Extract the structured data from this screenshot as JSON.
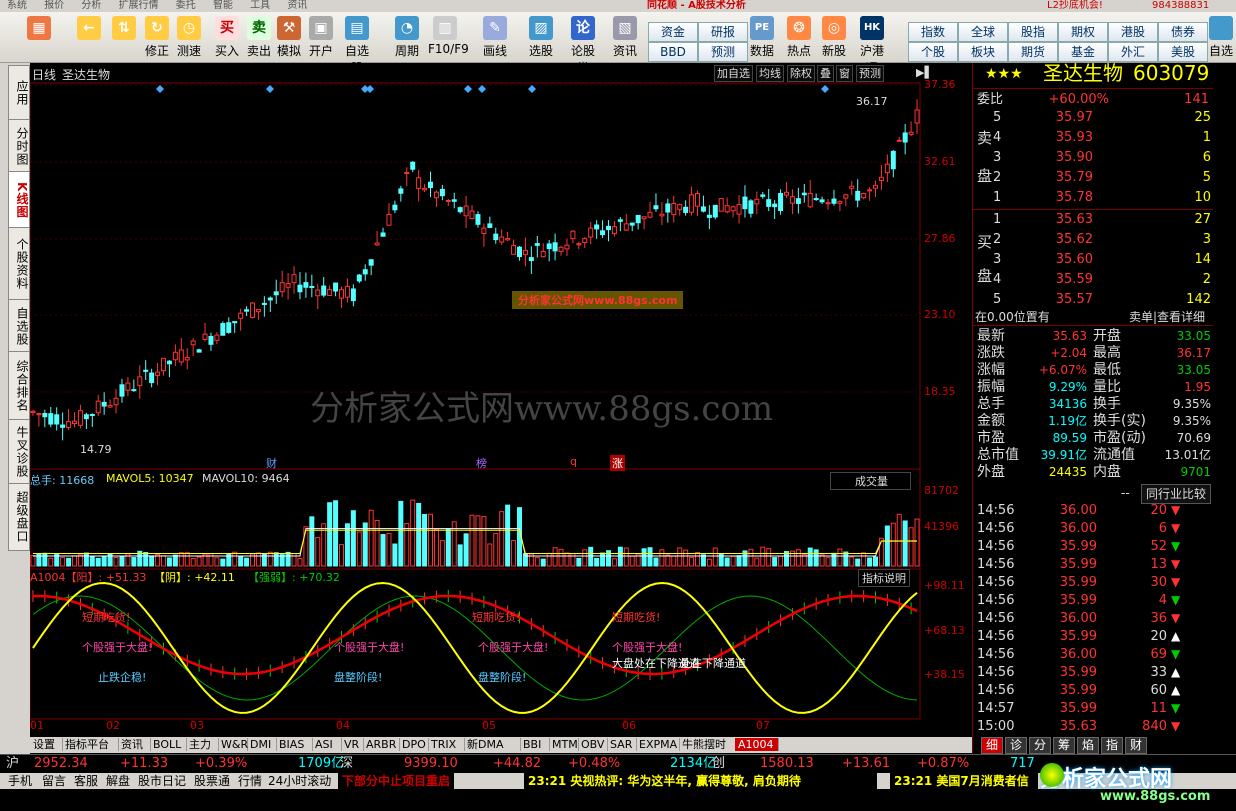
{
  "app": {
    "title": "同花顺 - A股技术分析",
    "promo": "L2抄底机会!",
    "account": "984388831"
  },
  "menu": [
    "系统",
    "报价",
    "分析",
    "扩展行情",
    "委托",
    "智能",
    "工具",
    "资讯"
  ],
  "toolbar": [
    {
      "name": "layout",
      "label": "",
      "icon": "▦"
    },
    {
      "name": "back",
      "label": "",
      "icon": "←"
    },
    {
      "name": "up-down",
      "label": "",
      "icon": "⇅"
    },
    {
      "name": "modify",
      "label": "修正",
      "icon": "↻"
    },
    {
      "name": "test",
      "label": "测速",
      "icon": "◷"
    },
    {
      "name": "buy",
      "label": "买入",
      "icon": "买"
    },
    {
      "name": "sell",
      "label": "卖出",
      "icon": "卖"
    },
    {
      "name": "simulate",
      "label": "模拟",
      "icon": "⚒"
    },
    {
      "name": "open",
      "label": "开户",
      "icon": "▣"
    },
    {
      "name": "watchlist",
      "label": "自选股",
      "icon": "▤"
    },
    {
      "name": "period",
      "label": "周期",
      "icon": "◔"
    },
    {
      "name": "f10",
      "label": "F10/F9",
      "icon": "▥"
    },
    {
      "name": "draw",
      "label": "画线",
      "icon": "✎"
    },
    {
      "name": "stockpick",
      "label": "选股",
      "icon": "▨"
    },
    {
      "name": "forum",
      "label": "论股堂",
      "icon": "论"
    },
    {
      "name": "news",
      "label": "资讯",
      "icon": "▧"
    },
    {
      "name": "data",
      "label": "数据",
      "icon": "PE"
    },
    {
      "name": "hot",
      "label": "热点",
      "icon": "❂"
    },
    {
      "name": "newstock",
      "label": "新股",
      "icon": "◎"
    },
    {
      "name": "hkconnect",
      "label": "沪港通",
      "icon": "HK"
    }
  ],
  "quick_buttons": [
    "资金",
    "研报",
    "BBD",
    "预测",
    "指数",
    "全球",
    "股指",
    "期权",
    "港股",
    "债券",
    "个股",
    "板块",
    "期货",
    "基金",
    "外汇",
    "美股"
  ],
  "toolbar_right": "自选",
  "left_tabs": [
    "应用",
    "分时图",
    "K线图",
    "个股资料",
    "自选股",
    "综合排名",
    "牛叉诊股",
    "超级盘口"
  ],
  "chart": {
    "period": "日线",
    "name": "圣达生物",
    "buttons": [
      "加自选",
      "均线",
      "除权",
      "叠",
      "窗",
      "预测"
    ],
    "price_axis": [
      "37.36",
      "32.61",
      "27.86",
      "23.10",
      "18.35"
    ],
    "high_label": "36.17",
    "low_label": "14.79",
    "watermark1": "分析家公式网www.88gs.com",
    "watermark2": "分析家公式网www.88gs.com",
    "events": [
      "财",
      "榜",
      "q",
      "涨"
    ],
    "vol_header": {
      "a": "总手: 11668",
      "b": "MAVOL5: 10347",
      "c": "MAVOL10: 9464"
    },
    "vol_select": "成交量",
    "vol_axis": [
      "81702",
      "41396"
    ],
    "ind_header": {
      "a": "A1004【阳】: +51.33",
      "b": "【阴】: +42.11",
      "c": "【强弱】: +70.32"
    },
    "ind_button": "指标说明",
    "ind_axis": [
      "+98.11",
      "+68.13",
      "+38.15"
    ],
    "ind_notes": [
      "短期吃货!",
      "个股强于大盘!",
      "大盘处在下降通道",
      "处在下降通道",
      "盘整阶段!",
      "止跌企稳!"
    ],
    "months": [
      "01",
      "02",
      "03",
      "04",
      "05",
      "06",
      "07"
    ]
  },
  "quote": {
    "stars": "★★★",
    "name": "圣达生物",
    "code": "603079",
    "weibi_label": "委比",
    "weibi": "+60.00%",
    "weicha": "141",
    "sell_label": [
      "卖",
      "盘"
    ],
    "buy_label": [
      "买",
      "盘"
    ],
    "sell": [
      [
        "5",
        "35.97",
        "25"
      ],
      [
        "4",
        "35.93",
        "1"
      ],
      [
        "3",
        "35.90",
        "6"
      ],
      [
        "2",
        "35.79",
        "5"
      ],
      [
        "1",
        "35.78",
        "10"
      ]
    ],
    "buy": [
      [
        "1",
        "35.63",
        "27"
      ],
      [
        "2",
        "35.62",
        "3"
      ],
      [
        "3",
        "35.60",
        "14"
      ],
      [
        "4",
        "35.59",
        "2"
      ],
      [
        "5",
        "35.57",
        "142"
      ]
    ],
    "pos_text": "在0.00位置有",
    "pos_right": "卖单|查看详细",
    "stats": [
      [
        "最新",
        "35.63",
        "开盘",
        "33.05"
      ],
      [
        "涨跌",
        "+2.04",
        "最高",
        "36.17"
      ],
      [
        "涨幅",
        "+6.07%",
        "最低",
        "33.05"
      ],
      [
        "振幅",
        "9.29%",
        "量比",
        "1.95"
      ],
      [
        "总手",
        "34136",
        "换手",
        "9.35%"
      ],
      [
        "金额",
        "1.19亿",
        "换手(实)",
        "9.35%"
      ],
      [
        "市盈",
        "89.59",
        "市盈(动)",
        "70.69"
      ],
      [
        "总市值",
        "39.91亿",
        "流通值",
        "13.01亿"
      ],
      [
        "外盘",
        "24435",
        "内盘",
        "9701"
      ]
    ],
    "compare": "同行业比较",
    "ticks": [
      [
        "14:56",
        "36.00",
        "20",
        "dn"
      ],
      [
        "14:56",
        "36.00",
        "6",
        "dn"
      ],
      [
        "14:56",
        "35.99",
        "52",
        "dn"
      ],
      [
        "14:56",
        "35.99",
        "13",
        "dn"
      ],
      [
        "14:56",
        "35.99",
        "30",
        "dn"
      ],
      [
        "14:56",
        "35.99",
        "4",
        "dn"
      ],
      [
        "14:56",
        "36.00",
        "36",
        "dn"
      ],
      [
        "14:56",
        "35.99",
        "20",
        "up"
      ],
      [
        "14:56",
        "36.00",
        "69",
        "dn"
      ],
      [
        "14:56",
        "35.99",
        "33",
        "up"
      ],
      [
        "14:56",
        "35.99",
        "60",
        "up"
      ],
      [
        "14:57",
        "35.99",
        "11",
        "dn"
      ],
      [
        "15:00",
        "35.63",
        "840",
        "dn"
      ]
    ],
    "right_tabs": [
      "细",
      "诊",
      "分",
      "筹",
      "焰",
      "指",
      "财"
    ]
  },
  "bottom_tabs": [
    "设置",
    "指标平台",
    "资讯",
    "BOLL",
    "主力",
    "W&R",
    "DMI",
    "BIAS",
    "ASI",
    "VR",
    "ARBR",
    "DPO",
    "TRIX",
    "新DMA",
    "BBI",
    "MTM",
    "OBV",
    "SAR",
    "EXPMA",
    "牛熊摆时",
    "A1004"
  ],
  "index_bar": {
    "sh": "沪",
    "sh_val": "2952.34",
    "sh_chg": "+11.33",
    "sh_pct": "+0.39%",
    "sh_amt": "1709亿",
    "sz": "深",
    "sz_val": "9399.10",
    "sz_chg": "+44.82",
    "sz_pct": "+0.48%",
    "sz_amt": "2134亿",
    "cy": "创",
    "cy_val": "1580.13",
    "cy_chg": "+13.61",
    "cy_pct": "+0.87%",
    "cy_amt": "717"
  },
  "status_bar": {
    "items": [
      "手机",
      "留言",
      "客服",
      "解盘",
      "股市日记",
      "股票通",
      "行情",
      "24小时滚动"
    ],
    "news1": "下部分中止项目重启",
    "news2": "23:21 央视热评: 华为这半年, 赢得尊敬, 肩负期待",
    "news3": "23:21 美国7月消费者信"
  },
  "brand": "分析家公式网",
  "brand_url": "www.88gs.com"
}
